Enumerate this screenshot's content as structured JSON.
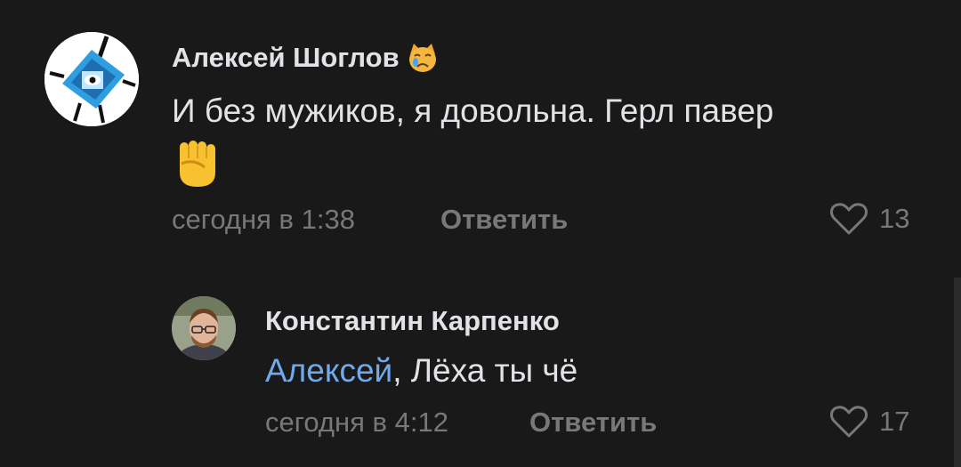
{
  "comments": [
    {
      "author": "Алексей Шоглов",
      "author_emoji": "😿",
      "text_line1": "И без мужиков, я довольна. Герл павер",
      "text_line2": "✊",
      "time": "сегодня в 1:38",
      "reply_label": "Ответить",
      "likes": "13"
    },
    {
      "author": "Константин Карпенко",
      "mention": "Алексей",
      "text": ", Лёха ты чё",
      "time": "сегодня в 4:12",
      "reply_label": "Ответить",
      "likes": "17"
    }
  ],
  "colors": {
    "background": "#19191a",
    "text": "#e1e3e6",
    "secondary": "#76787a",
    "link": "#71aaeb"
  },
  "icons": {
    "like": "heart-outline-icon",
    "author_emoji": "crying-cat-emoji",
    "body_emoji": "raised-fist-emoji"
  }
}
